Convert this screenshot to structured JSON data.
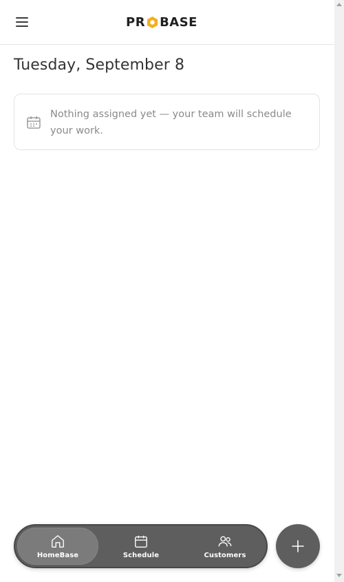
{
  "header": {
    "logo": {
      "left": "PR",
      "right": "BASE",
      "accent": "#f2b01e"
    },
    "menu_icon": "hamburger-icon"
  },
  "main": {
    "date_title": "Tuesday, September 8",
    "empty_state": {
      "icon": "calendar-icon",
      "message": "Nothing assigned yet — your team will schedule your work."
    }
  },
  "bottom_nav": {
    "items": [
      {
        "label": "HomeBase",
        "icon": "home-icon",
        "active": true
      },
      {
        "label": "Schedule",
        "icon": "calendar-icon",
        "active": false
      },
      {
        "label": "Customers",
        "icon": "users-icon",
        "active": false
      }
    ],
    "fab_icon": "plus-icon"
  },
  "colors": {
    "nav_bg": "#5e5e5e",
    "nav_active": "#7b7b7b",
    "text": "#333333",
    "muted": "#8a8a8a"
  }
}
